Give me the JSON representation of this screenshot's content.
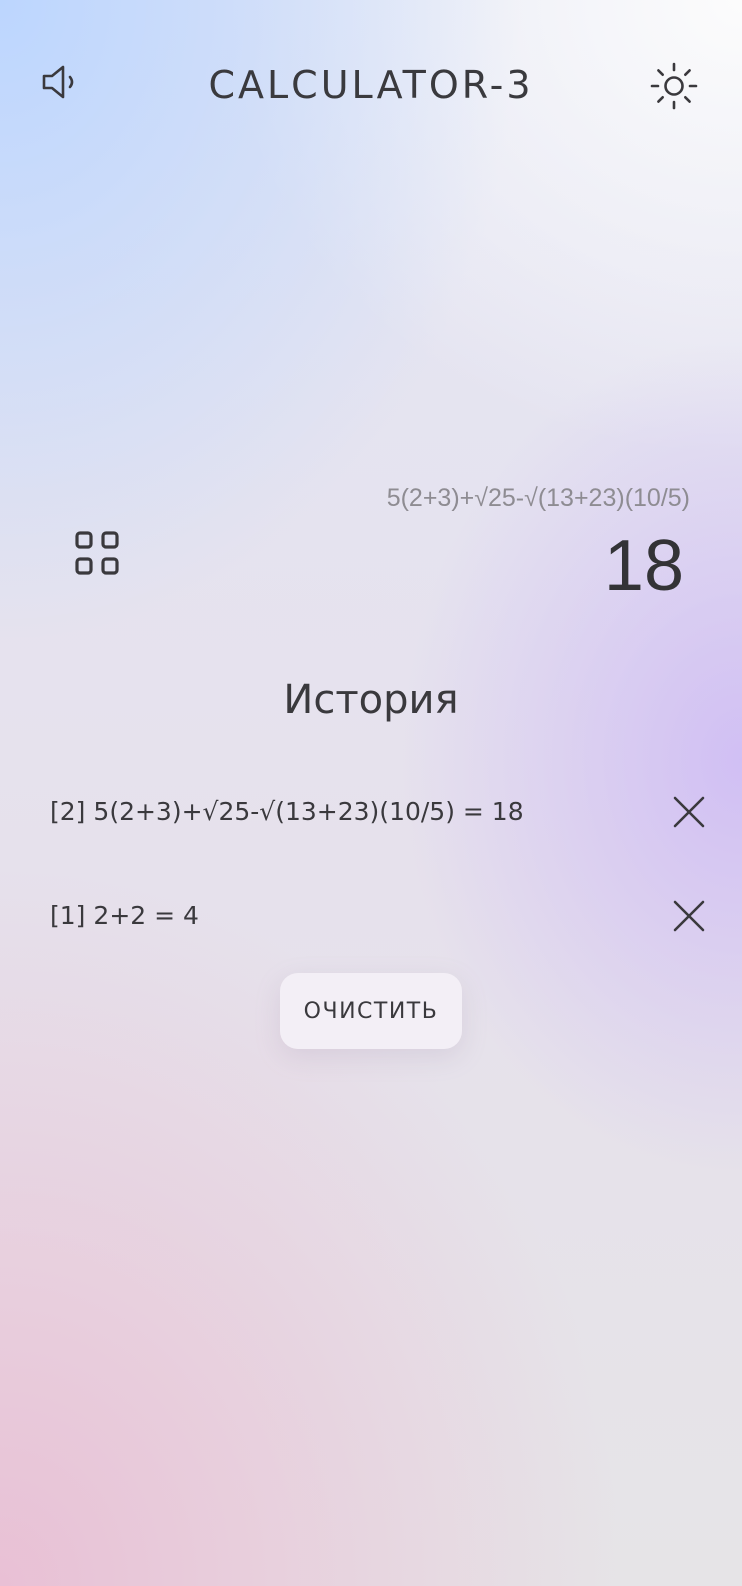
{
  "header": {
    "title": "CALCULATOR-3",
    "sound_icon": "speaker-icon",
    "theme_icon": "sun-icon"
  },
  "display": {
    "expression": "5(2+3)+√25-√(13+23)(10/5)",
    "result": "18",
    "mode_icon": "grid-icon"
  },
  "history": {
    "title": "История",
    "entries": [
      {
        "index": "[2]",
        "text": "5(2+3)+√25-√(13+23)(10/5) = 18",
        "delete_icon": "close-icon"
      },
      {
        "index": "[1]",
        "text": "2+2 = 4",
        "delete_icon": "close-icon"
      }
    ],
    "clear_label": "ОЧИСТИТЬ"
  },
  "colors": {
    "text": "#333333",
    "expression": "#8e8c92",
    "accent_blue": "#bad5ff",
    "accent_purple": "#cdb9f5",
    "accent_pink": "#e9bed4"
  }
}
